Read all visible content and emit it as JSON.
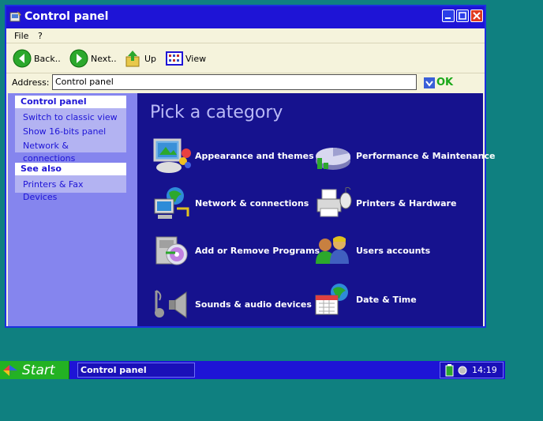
{
  "window": {
    "title": "Control panel"
  },
  "menu": [
    "File",
    "?"
  ],
  "toolbar": {
    "back": "Back..",
    "next": "Next..",
    "up": "Up",
    "view": "View"
  },
  "address": {
    "label": "Address:",
    "value": "Control panel",
    "go": "OK"
  },
  "sidebar": {
    "panel1": {
      "title": "Control panel",
      "items": [
        "Switch to classic view",
        "Show 16-bits panel",
        "Network & connections"
      ]
    },
    "panel2": {
      "title": "See also",
      "items": [
        "Printers & Fax Devices"
      ]
    }
  },
  "main": {
    "heading": "Pick a category",
    "categories": [
      {
        "label": "Appearance and themes",
        "icon": "appearance-icon"
      },
      {
        "label": "Performance & Maintenance",
        "icon": "performance-icon"
      },
      {
        "label": "Network & connections",
        "icon": "network-icon"
      },
      {
        "label": "Printers & Hardware",
        "icon": "printer-icon"
      },
      {
        "label": "Add or Remove Programs",
        "icon": "programs-icon"
      },
      {
        "label": "Users accounts",
        "icon": "users-icon"
      },
      {
        "label": "Sounds & audio devices",
        "icon": "sound-icon"
      },
      {
        "label": "Date & Time",
        "icon": "datetime-icon"
      }
    ]
  },
  "taskbar": {
    "start": "Start",
    "task": "Control panel",
    "clock": "14:19"
  },
  "colors": {
    "titlebar": "#1e14d6",
    "main_bg": "#16128e",
    "sidebar_bg": "#8585ee",
    "desktop": "#0f8080",
    "start": "#23b223"
  }
}
